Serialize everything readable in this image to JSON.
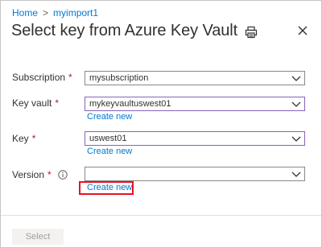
{
  "breadcrumb": {
    "items": [
      "Home",
      "myimport1"
    ],
    "separator": ">"
  },
  "panel": {
    "title": "Select key from Azure Key Vault"
  },
  "form": {
    "required_marker": "*",
    "subscription": {
      "label": "Subscription",
      "value": "mysubscription"
    },
    "key_vault": {
      "label": "Key vault",
      "value": "mykeyvaultuswest01",
      "create_new": "Create new"
    },
    "key": {
      "label": "Key",
      "value": "uswest01",
      "create_new": "Create new"
    },
    "version": {
      "label": "Version",
      "value": "",
      "create_new": "Create new",
      "info_icon": "info-icon"
    }
  },
  "footer": {
    "select_label": "Select"
  },
  "colors": {
    "link": "#0078d4",
    "required": "#a4262c",
    "highlight": "#e81123",
    "focus_border": "#8764b8"
  }
}
